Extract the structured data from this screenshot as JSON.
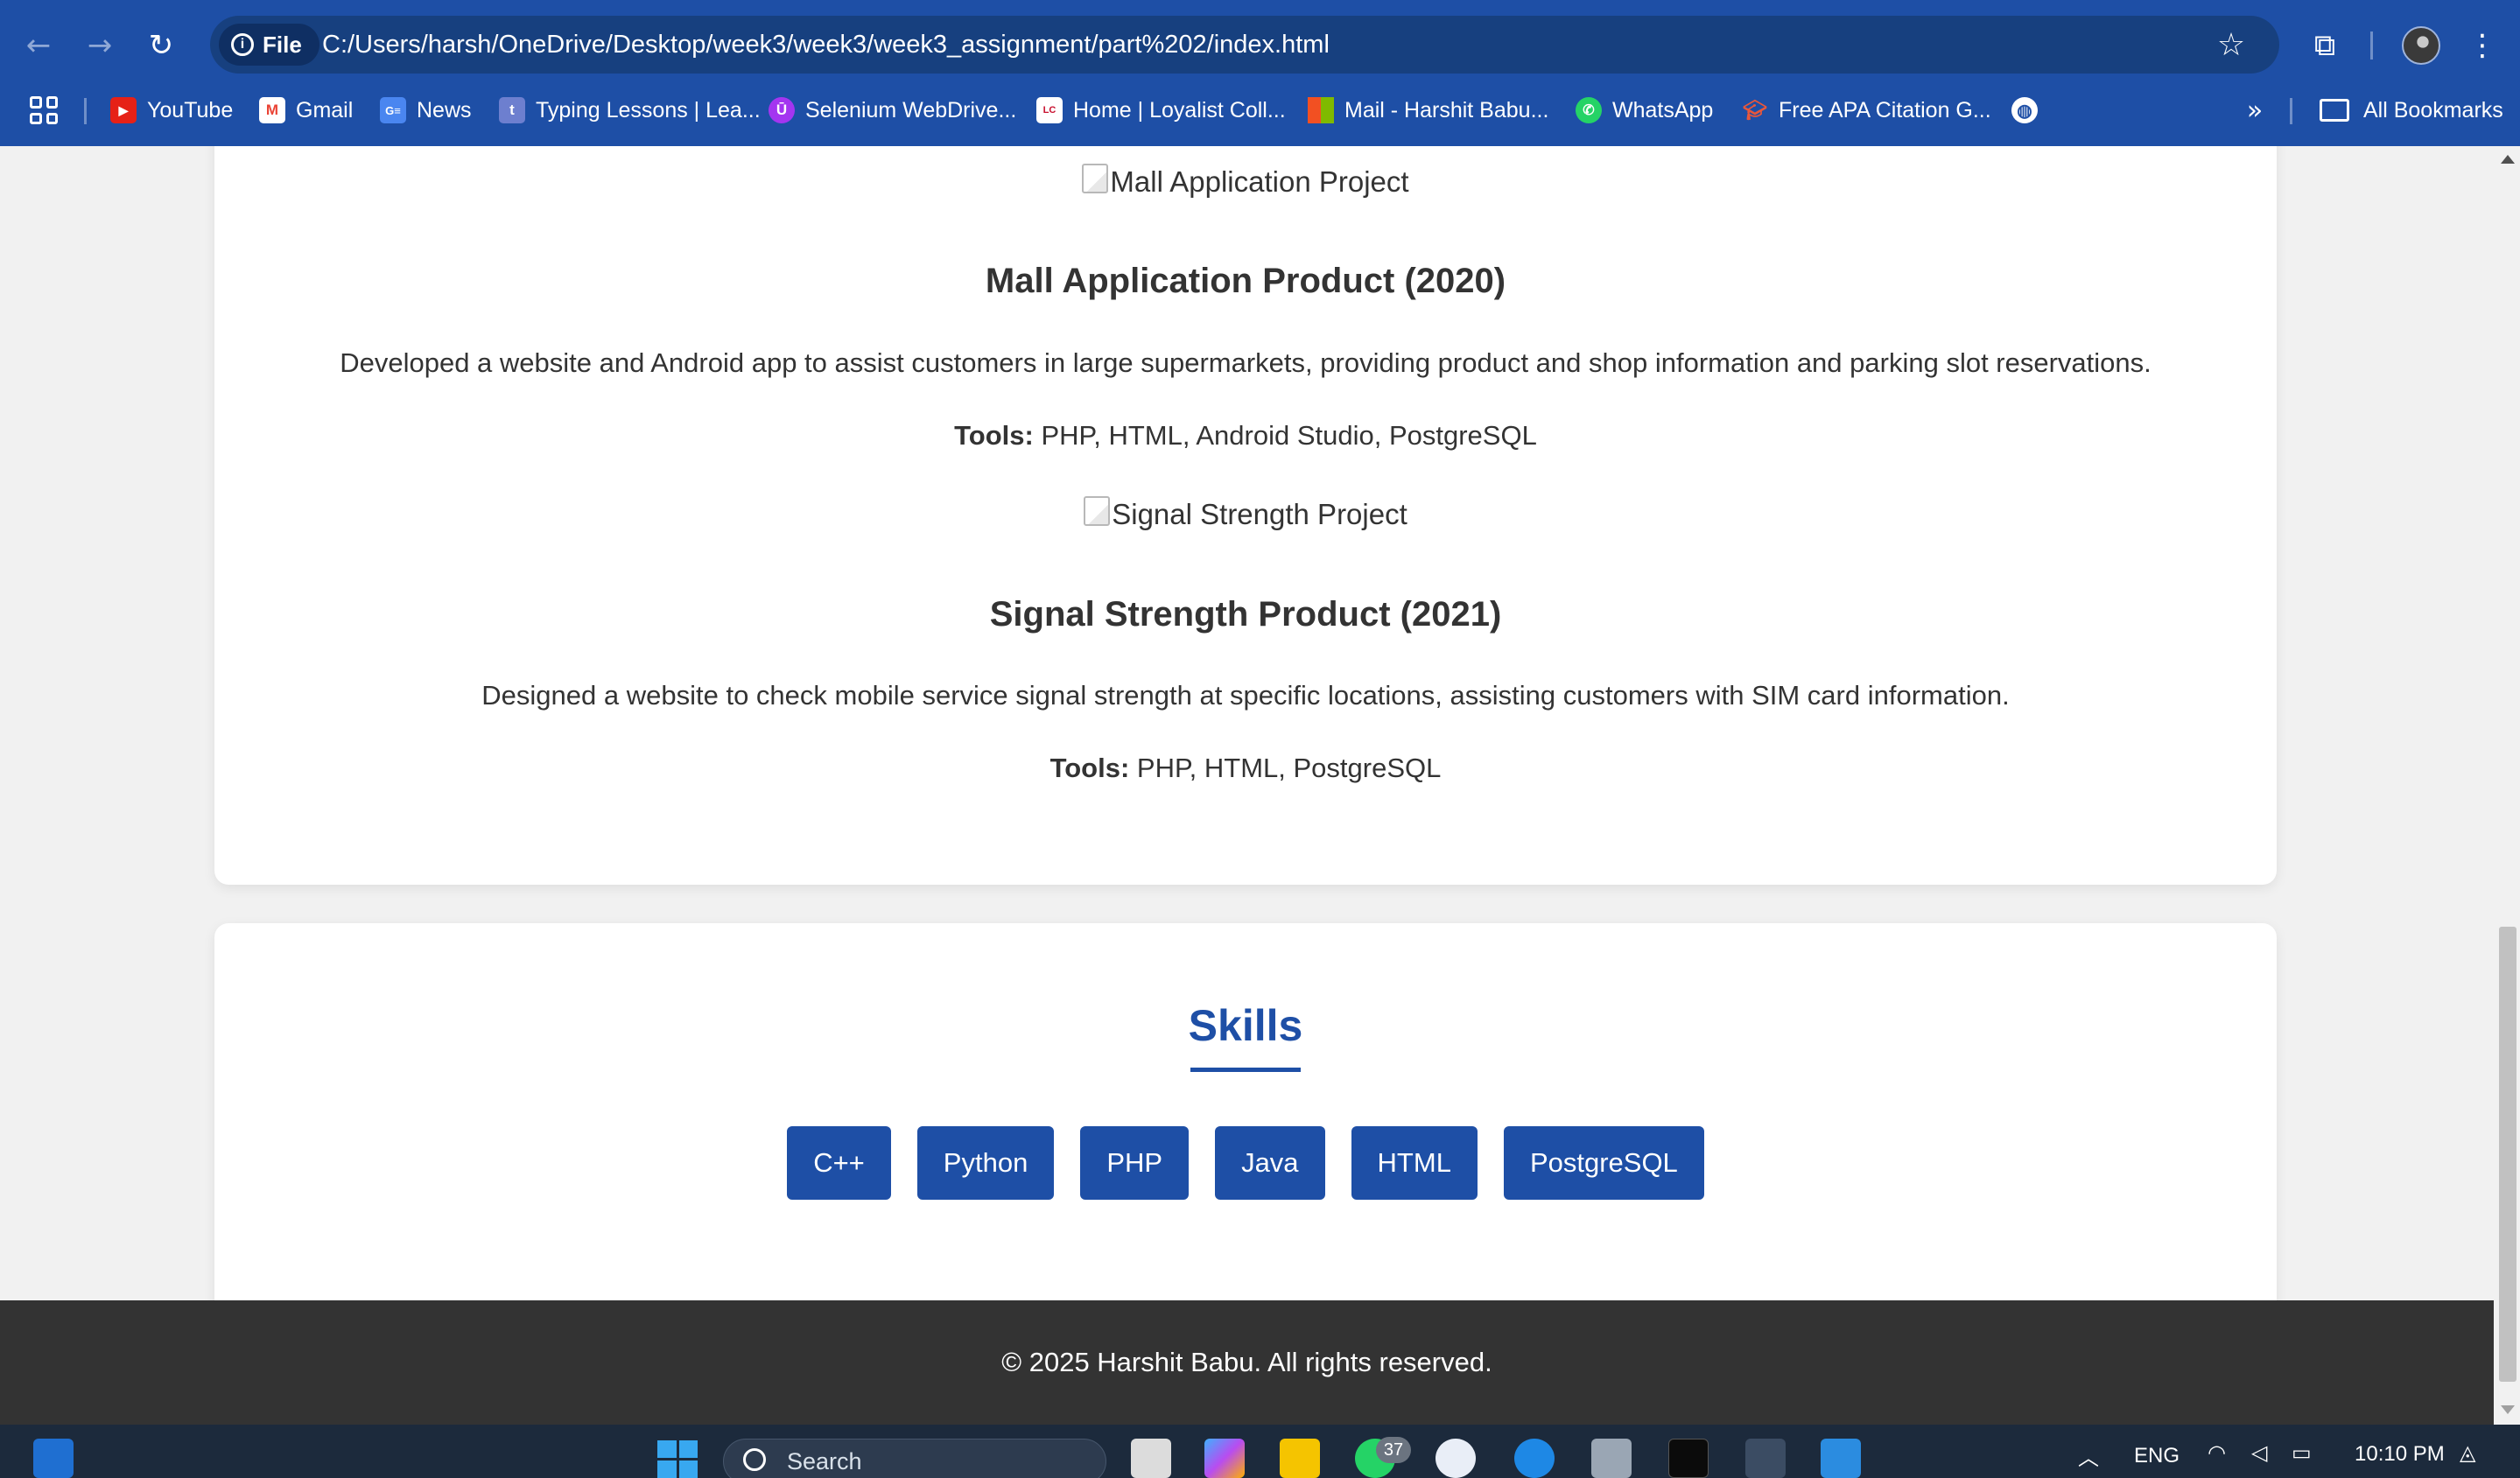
{
  "browser": {
    "site_chip": "File",
    "url": "C:/Users/harsh/OneDrive/Desktop/week3/week3/week3_assignment/part%202/index.html",
    "bookmarks": [
      {
        "label": "YouTube",
        "icon": "youtube-icon",
        "color": "#e62117"
      },
      {
        "label": "Gmail",
        "icon": "gmail-icon",
        "color": "#ffffff"
      },
      {
        "label": "News",
        "icon": "google-news-icon",
        "color": "#4a86f0"
      },
      {
        "label": "Typing Lessons | Lea...",
        "icon": "typing-icon",
        "color": "#6d7fcf"
      },
      {
        "label": "Selenium WebDrive...",
        "icon": "udemy-icon",
        "color": "#a435f0"
      },
      {
        "label": "Home | Loyalist Coll...",
        "icon": "loyalist-icon",
        "color": "#ffffff"
      },
      {
        "label": "Mail - Harshit Babu...",
        "icon": "microsoft-icon",
        "color": "#f25022"
      },
      {
        "label": "WhatsApp",
        "icon": "whatsapp-icon",
        "color": "#25d366"
      },
      {
        "label": "Free APA Citation G...",
        "icon": "citation-icon",
        "color": "#e8573b"
      }
    ],
    "all_bookmarks": "All Bookmarks"
  },
  "projects": [
    {
      "image_alt": "Mall Application Project",
      "title": "Mall Application Product (2020)",
      "description": "Developed a website and Android app to assist customers in large supermarkets, providing product and shop information and parking slot reservations.",
      "tools_label": "Tools:",
      "tools": "PHP, HTML, Android Studio, PostgreSQL"
    },
    {
      "image_alt": "Signal Strength Project",
      "title": "Signal Strength Product (2021)",
      "description": "Designed a website to check mobile service signal strength at specific locations, assisting customers with SIM card information.",
      "tools_label": "Tools:",
      "tools": "PHP, HTML, PostgreSQL"
    }
  ],
  "skills": {
    "title": "Skills",
    "items": [
      "C++",
      "Python",
      "PHP",
      "Java",
      "HTML",
      "PostgreSQL"
    ]
  },
  "footer": {
    "text": "© 2025 Harshit Babu. All rights reserved."
  },
  "taskbar": {
    "search_placeholder": "Search",
    "whatsapp_badge": "37",
    "language": "ENG",
    "time": "10:10 PM"
  },
  "colors": {
    "accent": "#1e4fa6",
    "footer_bg": "#333333",
    "page_bg": "#f1f1f1"
  }
}
